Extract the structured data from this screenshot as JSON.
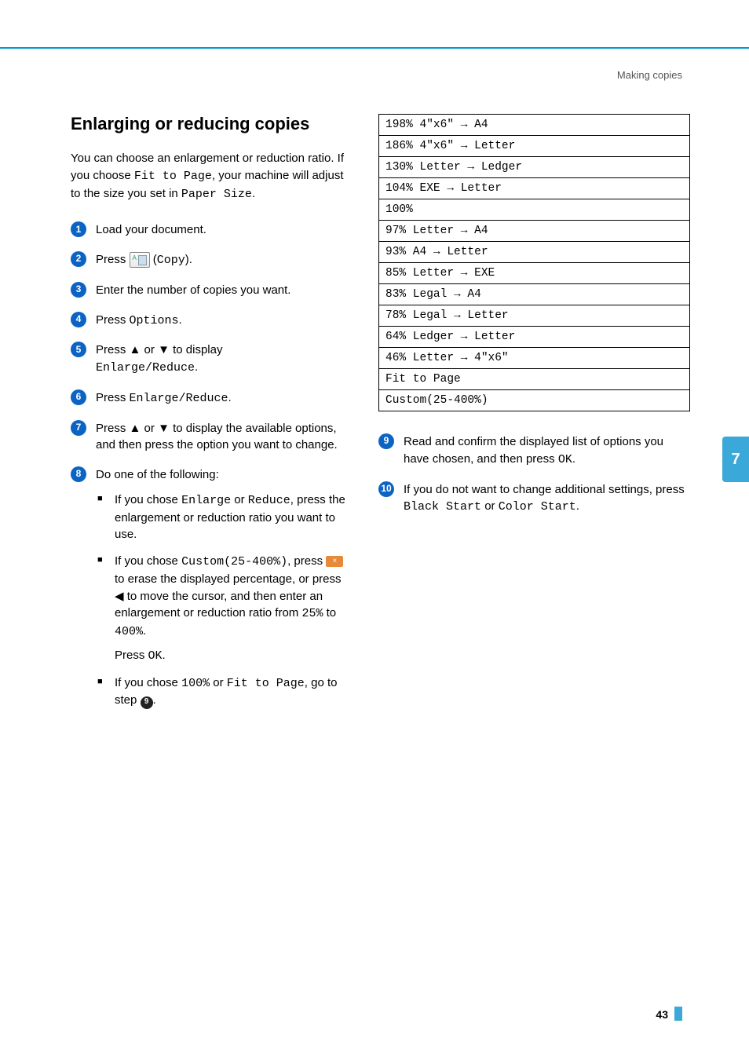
{
  "header": {
    "section": "Making copies"
  },
  "title": "Enlarging or reducing copies",
  "intro": {
    "p1a": "You can choose an enlargement or reduction ratio. If you choose ",
    "fit": "Fit to Page",
    "p1b": ", your machine will adjust to the size you set in ",
    "ps": "Paper Size",
    "p1c": "."
  },
  "steps": {
    "s1": "Load your document.",
    "s2a": "Press ",
    "s2b": " (",
    "s2c": "Copy",
    "s2d": ").",
    "s3": "Enter the number of copies you want.",
    "s4a": "Press ",
    "s4b": "Options",
    "s4c": ".",
    "s5a": "Press ",
    "s5up": "▲",
    "s5or": " or ",
    "s5dn": "▼",
    "s5b": " to display ",
    "s5c": "Enlarge/Reduce",
    "s5d": ".",
    "s6a": "Press ",
    "s6b": "Enlarge/Reduce",
    "s6c": ".",
    "s7a": "Press ",
    "s7b": " to display the available options, and then press the option you want to change.",
    "s8": "Do one of the following:",
    "b1a": "If you chose ",
    "b1b": "Enlarge",
    "b1c": " or ",
    "b1d": "Reduce",
    "b1e": ", press the enlargement or reduction ratio you want to use.",
    "b2a": "If you chose ",
    "b2b": "Custom(25-400%)",
    "b2c": ", press ",
    "b2d": " to erase the displayed percentage, or press ",
    "b2left": "◀",
    "b2e": " to move the cursor, and then enter an enlargement or reduction ratio from ",
    "b2f": "25%",
    "b2g": " to ",
    "b2h": "400%",
    "b2i": ".",
    "b2j": "Press ",
    "b2k": "OK",
    "b2l": ".",
    "b3a": "If you chose ",
    "b3b": "100%",
    "b3c": " or ",
    "b3d": "Fit to Page",
    "b3e": ", go to step ",
    "b3ref": "9",
    "b3f": ".",
    "s9a": "Read and confirm the displayed list of options you have chosen, and then press ",
    "s9b": "OK",
    "s9c": ".",
    "s10a": "If you do not want to change additional settings, press ",
    "s10b": "Black Start",
    "s10c": " or ",
    "s10d": "Color Start",
    "s10e": "."
  },
  "nums": {
    "n1": "1",
    "n2": "2",
    "n3": "3",
    "n4": "4",
    "n5": "5",
    "n6": "6",
    "n7": "7",
    "n8": "8",
    "n9": "9",
    "n10": "10"
  },
  "ratios": [
    "198% 4\"x6\" → A4",
    "186% 4\"x6\" → Letter",
    "130% Letter → Ledger",
    "104% EXE → Letter",
    "100%",
    "97% Letter → A4",
    "93% A4 → Letter",
    "85% Letter → EXE",
    "83% Legal → A4",
    "78% Legal → Letter",
    "64% Ledger → Letter",
    "46% Letter → 4\"x6\"",
    "Fit to Page",
    "Custom(25-400%)"
  ],
  "sidetab": "7",
  "pagenum": "43"
}
